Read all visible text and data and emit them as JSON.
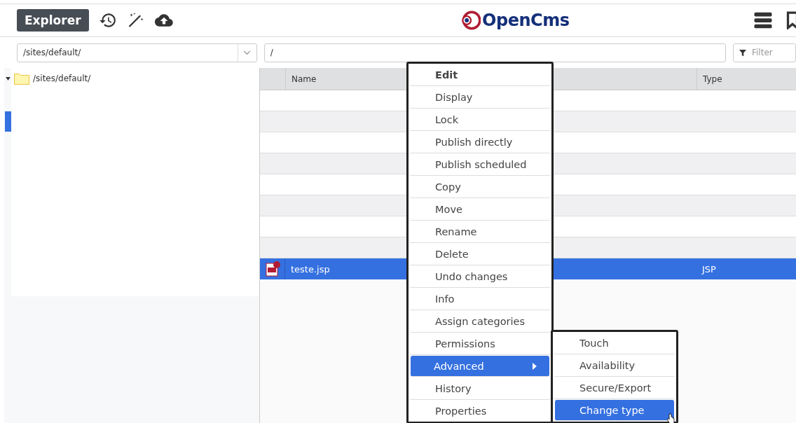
{
  "header": {
    "app_button": "Explorer",
    "logo": "OpenCms"
  },
  "toolbar": {
    "site_select": {
      "value": "/sites/default/"
    },
    "path_field": {
      "value": "/"
    },
    "filter_field": {
      "placeholder": "Filter"
    }
  },
  "tree": {
    "items": [
      {
        "label": "/sites/default/",
        "expanded": true
      }
    ]
  },
  "table": {
    "columns": [
      "Name",
      "Type"
    ],
    "rows": [
      {
        "name": "teste.jsp",
        "type": "JSP",
        "selected": true
      }
    ]
  },
  "context_menu": {
    "items": [
      {
        "label": "Edit",
        "default": true,
        "has_submenu": false,
        "selected": false
      },
      {
        "label": "Display",
        "default": false,
        "has_submenu": false,
        "selected": false
      },
      {
        "label": "Lock",
        "default": false,
        "has_submenu": false,
        "selected": false
      },
      {
        "label": "Publish directly",
        "default": false,
        "has_submenu": false,
        "selected": false
      },
      {
        "label": "Publish scheduled",
        "default": false,
        "has_submenu": false,
        "selected": false
      },
      {
        "label": "Copy",
        "default": false,
        "has_submenu": false,
        "selected": false
      },
      {
        "label": "Move",
        "default": false,
        "has_submenu": false,
        "selected": false
      },
      {
        "label": "Rename",
        "default": false,
        "has_submenu": false,
        "selected": false
      },
      {
        "label": "Delete",
        "default": false,
        "has_submenu": false,
        "selected": false
      },
      {
        "label": "Undo changes",
        "default": false,
        "has_submenu": false,
        "selected": false
      },
      {
        "label": "Info",
        "default": false,
        "has_submenu": false,
        "selected": false
      },
      {
        "label": "Assign categories",
        "default": false,
        "has_submenu": false,
        "selected": false
      },
      {
        "label": "Permissions",
        "default": false,
        "has_submenu": false,
        "selected": false
      },
      {
        "label": "Advanced",
        "default": false,
        "has_submenu": true,
        "selected": true
      },
      {
        "label": "History",
        "default": false,
        "has_submenu": false,
        "selected": false
      },
      {
        "label": "Properties",
        "default": false,
        "has_submenu": false,
        "selected": false
      }
    ]
  },
  "submenu": {
    "items": [
      {
        "label": "Touch",
        "selected": false
      },
      {
        "label": "Availability",
        "selected": false
      },
      {
        "label": "Secure/Export",
        "selected": false
      },
      {
        "label": "Change type",
        "selected": true
      }
    ]
  }
}
